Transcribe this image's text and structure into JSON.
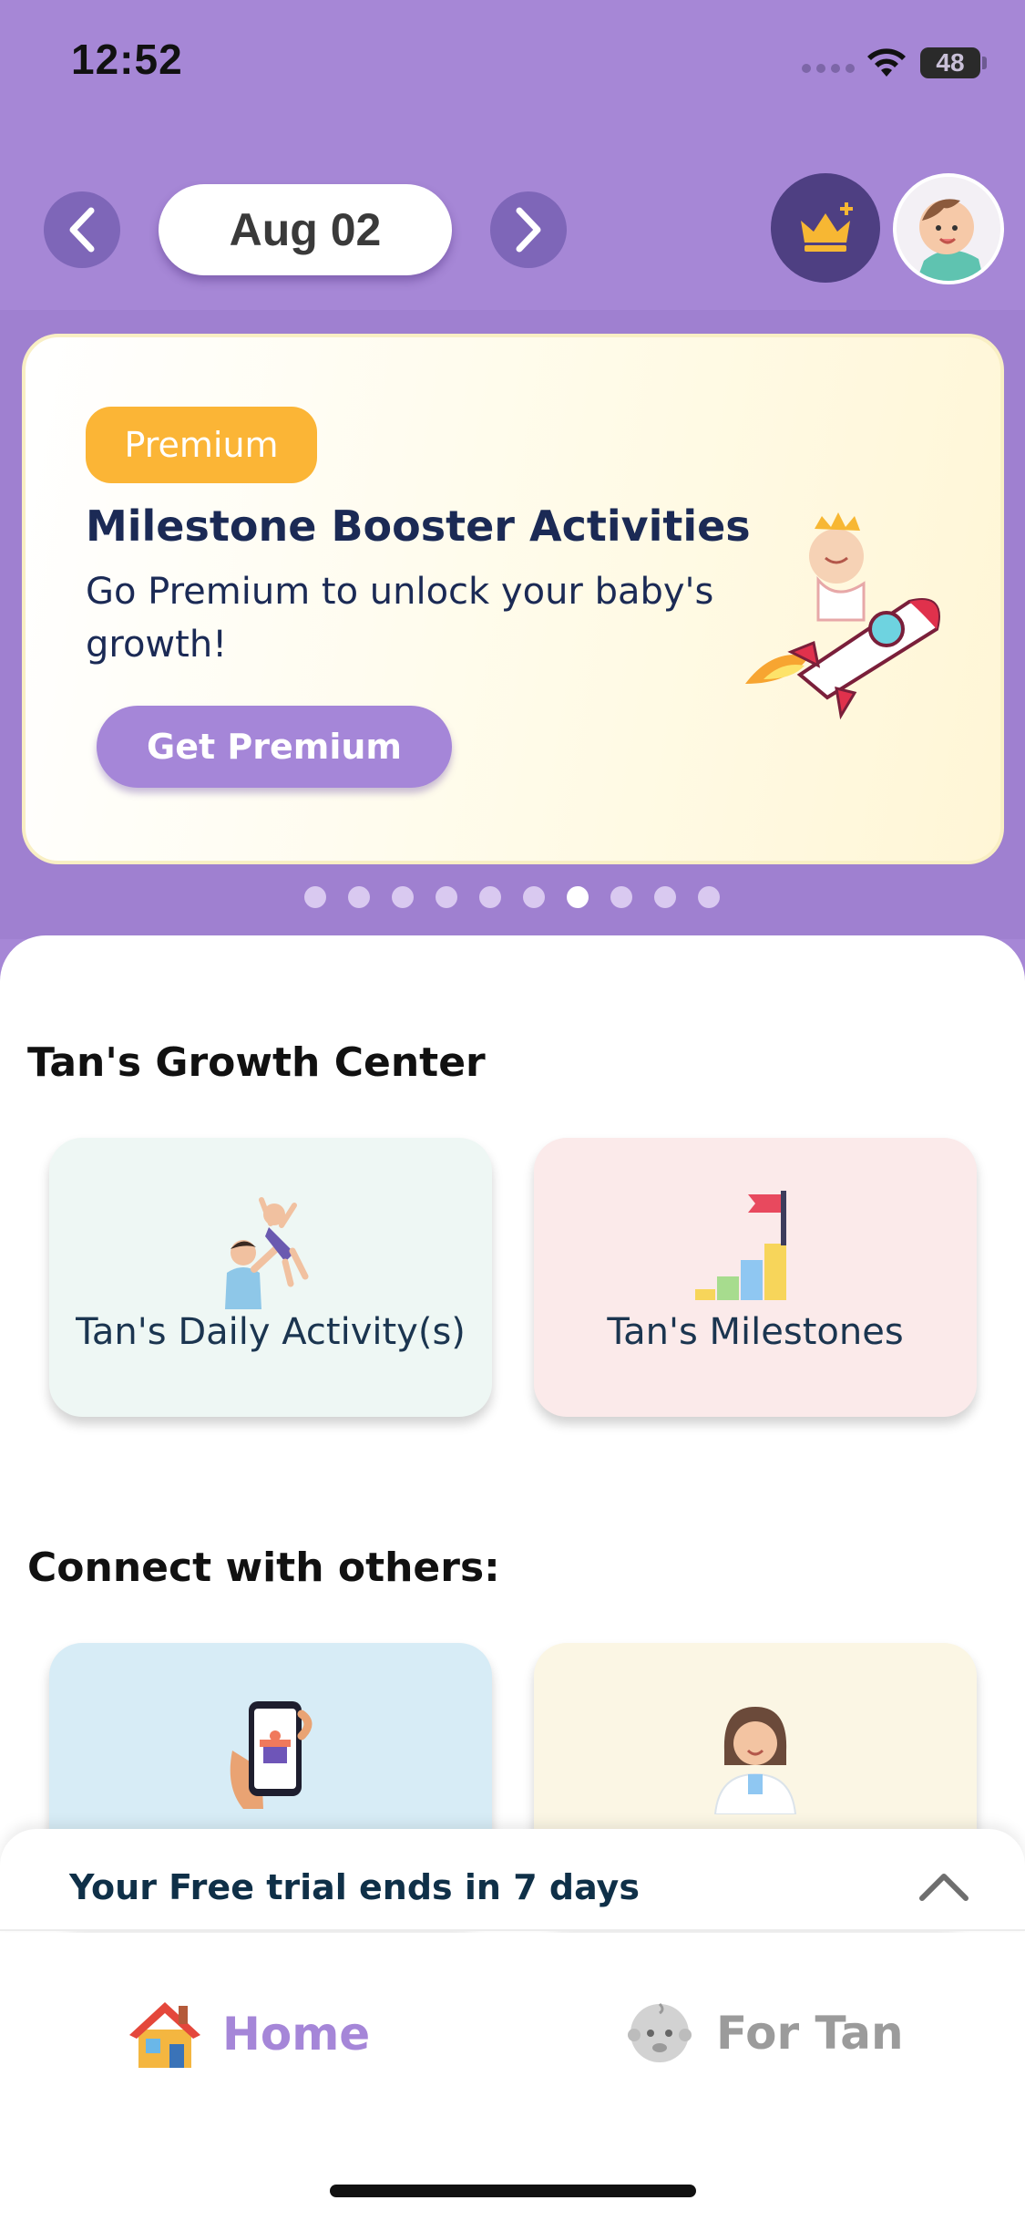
{
  "status_bar": {
    "time": "12:52",
    "battery": "48"
  },
  "header": {
    "date": "Aug 02",
    "prev_icon": "chevron-left-icon",
    "next_icon": "chevron-right-icon",
    "crown_icon": "crown-icon",
    "avatar_icon": "baby-avatar-icon"
  },
  "banner": {
    "badge": "Premium",
    "title": "Milestone Booster Activities",
    "subtitle": "Go Premium to unlock your baby's growth!",
    "button": "Get Premium",
    "illustration": "rocket-baby-icon",
    "page_count": 10,
    "active_index": 6
  },
  "growth_center": {
    "title": "Tan's Growth Center",
    "cards": [
      {
        "label": "Tan's Daily Activity(s)",
        "icon": "parent-child-icon",
        "color": "#eef7f4"
      },
      {
        "label": "Tan's Milestones",
        "icon": "milestone-flag-icon",
        "color": "#fbeaea"
      }
    ]
  },
  "connect": {
    "title": "Connect with others:",
    "cards": [
      {
        "label": "",
        "icon": "phone-gift-icon",
        "color": "#d7ecf6"
      },
      {
        "label": "",
        "icon": "doctor-icon",
        "color": "#fbf6e4"
      }
    ]
  },
  "trial": {
    "text": "Your Free trial ends in 7 days",
    "icon": "chevron-up-icon"
  },
  "tabs": [
    {
      "label": "Home",
      "icon": "house-icon",
      "active": true
    },
    {
      "label": "For Tan",
      "icon": "baby-face-icon",
      "active": false
    }
  ],
  "colors": {
    "brand_purple": "#a586d8",
    "premium_orange": "#fbb536",
    "header_bg": "#a687d6"
  }
}
